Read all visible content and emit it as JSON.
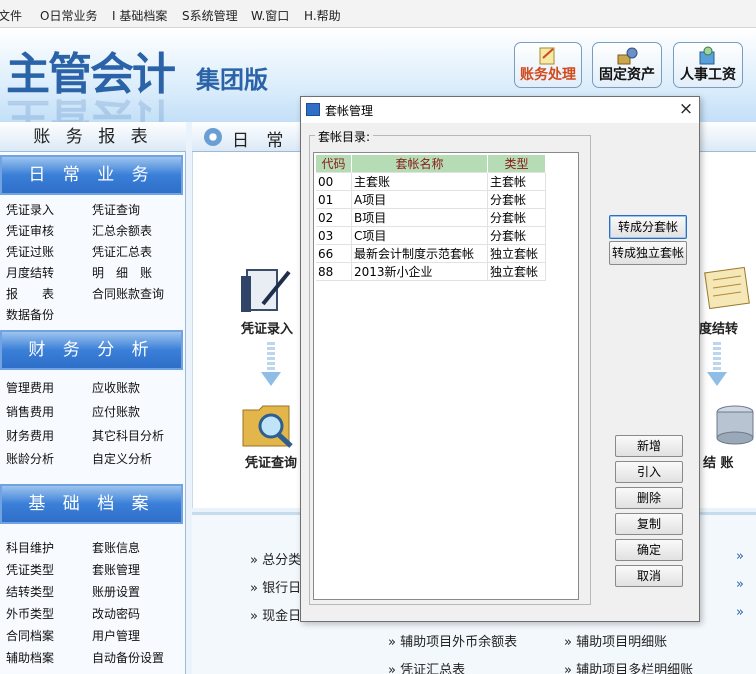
{
  "menu": {
    "items": [
      "文件",
      "O日常业务",
      "I 基础档案",
      "S系统管理",
      "W.窗口",
      "H.帮助"
    ]
  },
  "banner": {
    "logo_main": "主管会计",
    "logo_sub": "集团版",
    "buttons": [
      {
        "label": "账务处理",
        "icon": "accounting-icon",
        "color": "#d24a1c"
      },
      {
        "label": "固定资产",
        "icon": "asset-icon",
        "color": "#111111"
      },
      {
        "label": "人事工资",
        "icon": "payroll-icon",
        "color": "#111111"
      }
    ]
  },
  "left_nav": {
    "title": "账 务 报 表",
    "sections": [
      {
        "title": "日 常 业 务",
        "items": [
          "凭证录入",
          "凭证查询",
          "凭证审核",
          "汇总余额表",
          "凭证过账",
          "凭证汇总表",
          "月度结转",
          "明　细　账",
          "报　　表",
          "合同账款查询",
          "数据备份"
        ]
      },
      {
        "title": "财 务 分 析",
        "items": [
          "管理费用",
          "应收账款",
          "销售费用",
          "应付账款",
          "财务费用",
          "其它科目分析",
          "账龄分析",
          "自定义分析"
        ]
      },
      {
        "title": "基 础 档 案",
        "items": [
          "科目维护",
          "套账信息",
          "凭证类型",
          "套账管理",
          "结转类型",
          "账册设置",
          "外币类型",
          "改动密码",
          "合同档案",
          "用户管理",
          "辅助档案",
          "自动备份设置"
        ]
      }
    ]
  },
  "main": {
    "title": "日 常 业",
    "flow": [
      "凭证录入",
      "凭证查询",
      "度结转",
      "结 账"
    ],
    "links": [
      "总分类",
      "银行日",
      "现金日",
      "辅助项目外币余额表",
      "辅助项目明细账",
      "凭证汇总表",
      "辅助项目多栏明细账"
    ]
  },
  "dialog": {
    "title": "套帐管理",
    "close": "×",
    "group_label": "套帐目录:",
    "columns": [
      "代码",
      "套帐名称",
      "类型"
    ],
    "rows": [
      [
        "00",
        "主套账",
        "主套帐"
      ],
      [
        "01",
        "A项目",
        "分套帐"
      ],
      [
        "02",
        "B项目",
        "分套帐"
      ],
      [
        "03",
        "C项目",
        "分套帐"
      ],
      [
        "66",
        "最新会计制度示范套帐",
        "独立套帐"
      ],
      [
        "88",
        "2013新小企业",
        "独立套帐"
      ]
    ],
    "buttons": {
      "to_sub": "转成分套帐",
      "to_independent": "转成独立套帐",
      "add": "新增",
      "import": "引入",
      "delete": "删除",
      "copy": "复制",
      "ok": "确定",
      "cancel": "取消"
    }
  }
}
